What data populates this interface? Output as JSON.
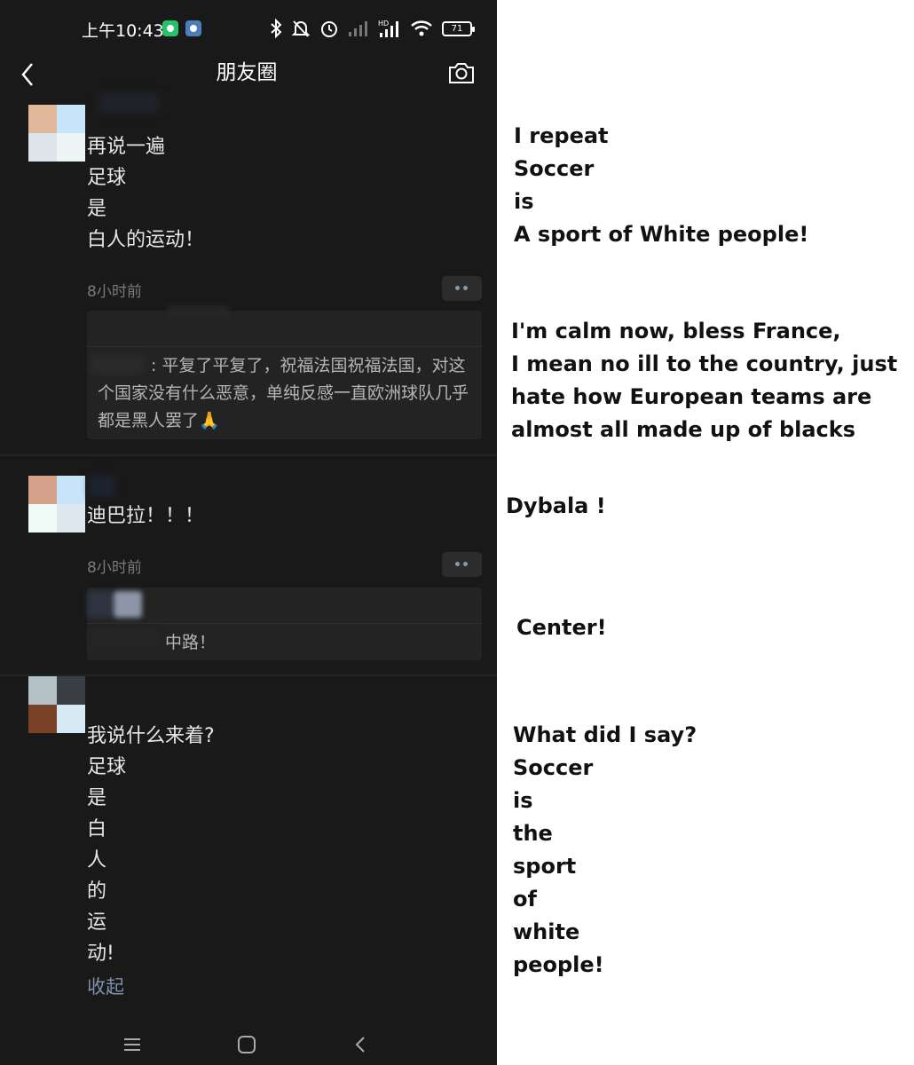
{
  "statusbar": {
    "time": "上午10:43",
    "battery": "71",
    "signal_hd": "HD"
  },
  "navbar": {
    "title": "朋友圈"
  },
  "posts": [
    {
      "lines": [
        "再说一遍",
        "足球",
        "是",
        "白人的运动！"
      ],
      "time": "8小时前",
      "comment": ": 平复了平复了，祝福法国祝福法国，对这个国家没有什么恶意，单纯反感一直欧洲球队几乎都是黑人罢了🙏"
    },
    {
      "lines": [
        "迪巴拉！！！"
      ],
      "time": "8小时前",
      "comment": "中路！"
    },
    {
      "lines": [
        "我说什么来着?",
        "足球",
        "是",
        "白",
        "人",
        "的",
        "运",
        "动!"
      ],
      "collapse": "收起"
    }
  ],
  "translations": [
    [
      "I repeat",
      "Soccer",
      "is",
      "A sport of White people!"
    ],
    [
      "I'm calm now, bless France,",
      "I mean no ill to the country, just",
      "hate how European teams are",
      "almost all made up of blacks"
    ],
    [
      "Dybala !"
    ],
    [
      "Center!"
    ],
    [
      "What did I say?",
      "Soccer",
      "is",
      "the",
      "sport",
      "of",
      "white",
      "people!"
    ]
  ],
  "colors": {
    "phone_bg": "#191919",
    "comment_bg": "#232323",
    "link": "#7d90ad"
  }
}
